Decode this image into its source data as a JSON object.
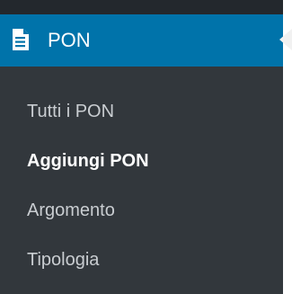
{
  "menu": {
    "title": "PON",
    "icon": "document-icon",
    "accent_color": "#0073aa",
    "items": [
      {
        "label": "Tutti i PON",
        "current": false
      },
      {
        "label": "Aggiungi PON",
        "current": true
      },
      {
        "label": "Argomento",
        "current": false
      },
      {
        "label": "Tipologia",
        "current": false
      }
    ]
  }
}
